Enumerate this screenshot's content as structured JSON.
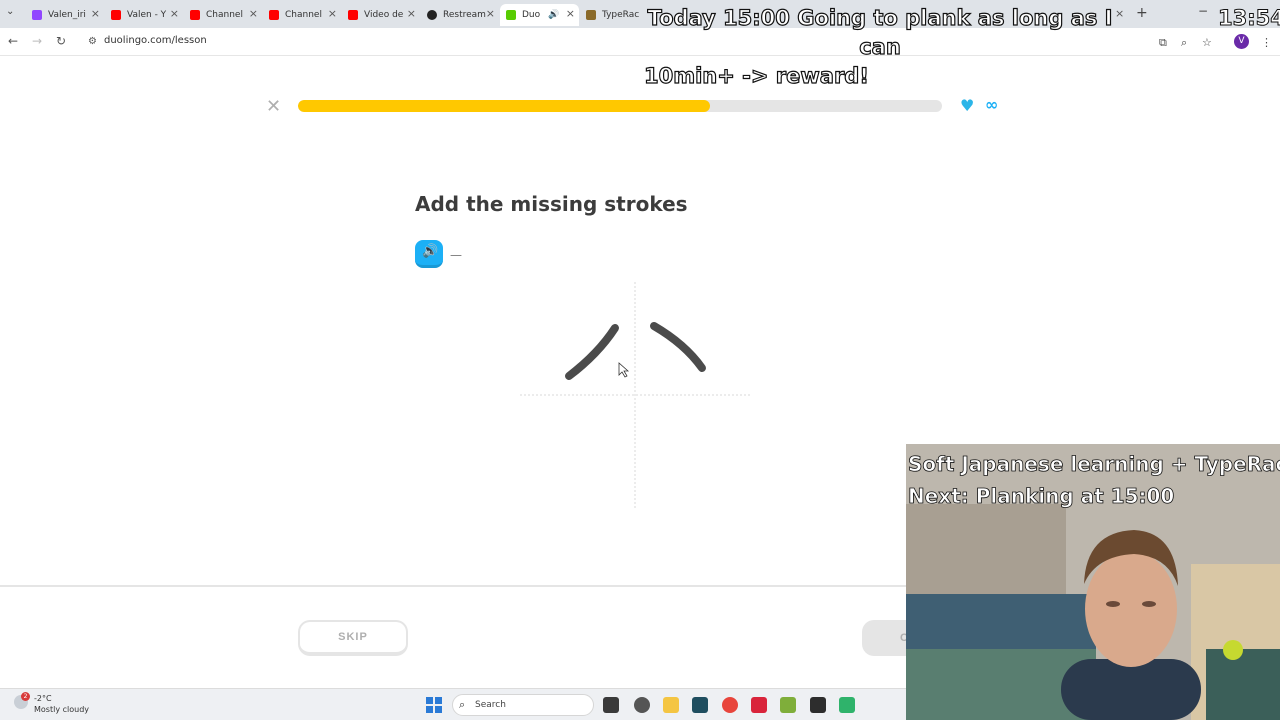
{
  "browser": {
    "tabs": [
      {
        "title": "Valen_iri",
        "icon": "twitch-icon",
        "color": "#9146ff"
      },
      {
        "title": "Valen - Y",
        "icon": "youtube-icon",
        "color": "#ff0000"
      },
      {
        "title": "Channel",
        "icon": "youtube-icon",
        "color": "#ff0000"
      },
      {
        "title": "Channel",
        "icon": "youtube-icon",
        "color": "#ff0000"
      },
      {
        "title": "Video de",
        "icon": "youtube-icon",
        "color": "#ff0000"
      },
      {
        "title": "Restream",
        "icon": "restream-icon",
        "color": "#222222"
      },
      {
        "title": "Duo",
        "icon": "duolingo-icon",
        "color": "#58cc02",
        "active": true
      },
      {
        "title": "TypeRac",
        "icon": "typeracer-icon",
        "color": "#8a6a2a"
      }
    ],
    "url": "duolingo.com/lesson",
    "profile_initial": "V"
  },
  "overlay": {
    "top_line1": "Today 15:00 Going to plank as long as I can",
    "top_line2": "10min+ -> reward!",
    "clock": "13:54",
    "cam_line1": "Soft Japanese learning + TypeRac",
    "cam_line2": "Next: Planking at 15:00"
  },
  "lesson": {
    "progress": 0.64,
    "hearts": "∞",
    "title": "Add the missing strokes",
    "reading": "—",
    "skip_label": "SKIP",
    "check_label": "C",
    "colors": {
      "progress": "#ffc800",
      "accent": "#1cb0f6"
    }
  },
  "taskbar": {
    "temperature": "-2°C",
    "weather": "Mostly cloudy",
    "notification_count": "2",
    "search_label": "Search"
  }
}
